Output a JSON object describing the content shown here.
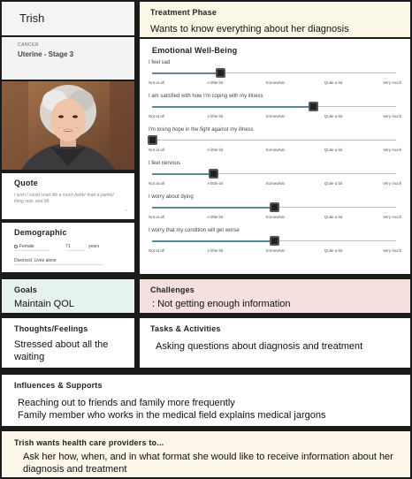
{
  "persona": {
    "name": "Trish",
    "cancer_label": "CANCER",
    "cancer_value": "Uterine - Stage 3"
  },
  "quote": {
    "heading": "Quote",
    "text": "I wish I could reset life a much better than a painful thing now, and Mr.",
    "mark": "\""
  },
  "demographic": {
    "heading": "Demographic",
    "gender": "Female",
    "age": "71",
    "age_unit": "years",
    "status": "Divorced, Lives alone"
  },
  "treatment_phase": {
    "heading": "Treatment Phase",
    "value": "Wants to know everything about her diagnosis"
  },
  "emotional_wellbeing": {
    "heading": "Emotional Well-Being",
    "scale_labels": [
      "Not at all",
      "A little bit",
      "Somewhat",
      "Quite a bit",
      "Very much"
    ],
    "items": [
      {
        "statement": "I feel sad",
        "level": 0.28
      },
      {
        "statement": "I am satisfied with how I'm coping with my illness",
        "level": 0.66
      },
      {
        "statement": "I'm losing hope in the fight against my illness",
        "level": 0.0
      },
      {
        "statement": "I feel nervous",
        "level": 0.25
      },
      {
        "statement": "I worry about dying",
        "level": 0.5
      },
      {
        "statement": "I worry that my condition will get worse",
        "level": 0.5
      }
    ]
  },
  "goals": {
    "heading": "Goals",
    "value": "Maintain QOL"
  },
  "challenges": {
    "heading": "Challenges",
    "value": ":  Not getting enough information"
  },
  "thoughts": {
    "heading": "Thoughts/Feelings",
    "value": "Stressed about all the waiting"
  },
  "tasks": {
    "heading": "Tasks & Activities",
    "value": "Asking questions about diagnosis and treatment"
  },
  "influences": {
    "heading": "Influences & Supports",
    "line1": "Reaching out to friends and family more frequently",
    "line2": "Family member who works in the medical field explains medical jargons"
  },
  "wants": {
    "heading": "Trish wants health care providers to...",
    "value": "Ask her how, when, and in what format she would like to receive information about her diagnosis and treatment"
  },
  "colors": {
    "page_bg": "#1b1b1b",
    "phase_bg": "#fbf8e8",
    "goals_bg": "#e6f2ef",
    "challenges_bg": "#f6e0dd",
    "wants_bg": "#fbf6e9",
    "slider_accent": "#5a8a95"
  }
}
